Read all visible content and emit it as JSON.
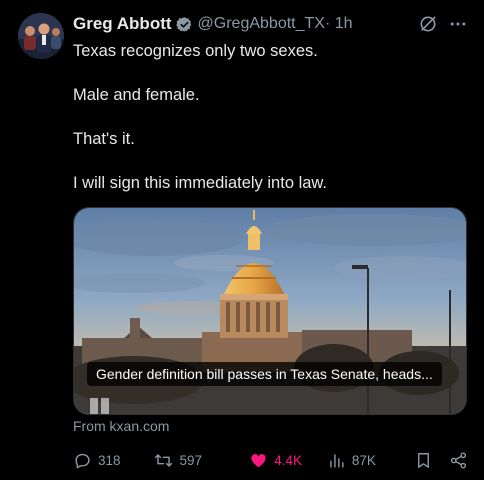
{
  "tweet": {
    "author_name": "Greg Abbott",
    "handle": "@GregAbbott_TX",
    "time": " · 1h",
    "lines": [
      "Texas recognizes only two sexes.",
      "Male and female.",
      "That's it.",
      "I will sign this immediately into law."
    ]
  },
  "card": {
    "caption": "Gender definition bill passes in Texas Senate, heads...",
    "source": "From kxan.com"
  },
  "actions": {
    "replies": "318",
    "retweets": "597",
    "likes": "4.4K",
    "views": "87K"
  },
  "colors": {
    "background": "#000000",
    "text": "#e7e9ea",
    "muted": "#8b98a5",
    "verified": "#8b98a5",
    "like": "#f91880"
  },
  "icons": [
    "verified-badge-icon",
    "grok-icon",
    "more-icon",
    "reply-icon",
    "retweet-icon",
    "heart-icon",
    "views-icon",
    "bookmark-icon",
    "share-icon"
  ]
}
